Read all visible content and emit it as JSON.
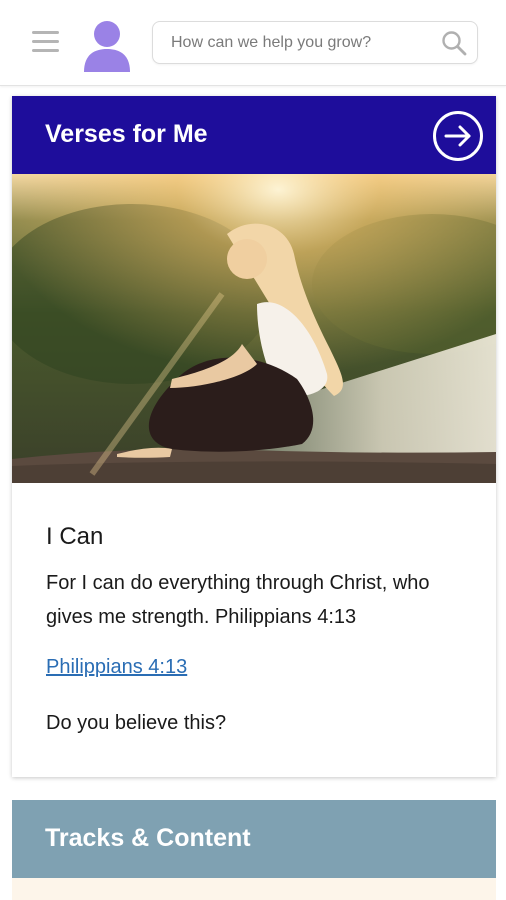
{
  "header": {
    "menu_icon": "hamburger-menu-icon",
    "avatar_icon": "user-avatar-icon",
    "search": {
      "placeholder": "How can we help you grow?",
      "value": "",
      "icon": "search-icon"
    }
  },
  "verse_card": {
    "title": "Verses for Me",
    "arrow_icon": "arrow-right-circle-icon",
    "image_icon": "woman-sunset-photo",
    "verse_title": "I Can",
    "verse_text": "For I can do everything through Christ, who gives me strength. Philippians 4:13",
    "reference_link": "Philippians 4:13",
    "question": "Do you believe this?"
  },
  "tracks": {
    "title": "Tracks & Content"
  },
  "colors": {
    "header_accent": "#1e0d9b",
    "tracks_accent": "#7fa1b2",
    "avatar": "#9a82e6",
    "link": "#2a6db4"
  }
}
